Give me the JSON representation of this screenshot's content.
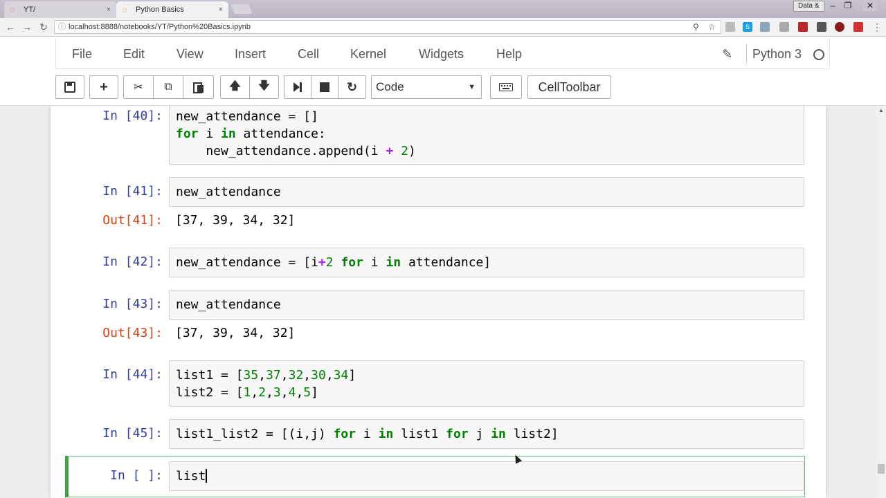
{
  "browser": {
    "tabs": [
      {
        "title": "YT/",
        "active": false
      },
      {
        "title": "Python Basics",
        "active": true
      }
    ],
    "close_glyph": "×",
    "profile_label": "Data &",
    "url": "localhost:8888/notebooks/YT/Python%20Basics.ipynb"
  },
  "jupyter": {
    "menu": [
      "File",
      "Edit",
      "View",
      "Insert",
      "Cell",
      "Kernel",
      "Widgets",
      "Help"
    ],
    "kernel_name": "Python 3",
    "cell_type": "Code",
    "celltoolbar_label": "CellToolbar"
  },
  "cells": {
    "c40": {
      "prompt": "In [40]:"
    },
    "c41": {
      "prompt": "In [41]:",
      "code": "new_attendance",
      "out_prompt": "Out[41]:",
      "output": "[37, 39, 34, 32]"
    },
    "c42": {
      "prompt": "In [42]:"
    },
    "c43": {
      "prompt": "In [43]:",
      "code": "new_attendance",
      "out_prompt": "Out[43]:",
      "output": "[37, 39, 34, 32]"
    },
    "c44": {
      "prompt": "In [44]:"
    },
    "c45": {
      "prompt": "In [45]:"
    },
    "active": {
      "prompt": "In [ ]:",
      "code": "list"
    }
  },
  "colors": {
    "prompt_in": "#303f9f",
    "prompt_out": "#d84315",
    "keyword": "#008000",
    "operator": "#aa22ff",
    "selected_border": "#42a047"
  }
}
